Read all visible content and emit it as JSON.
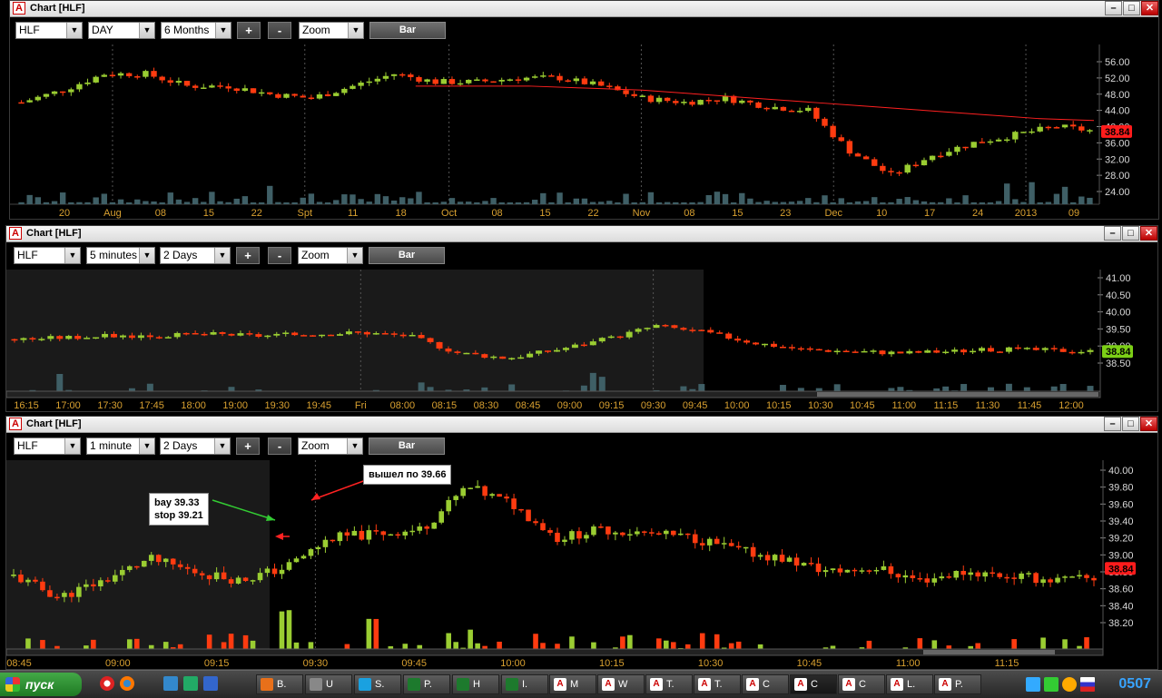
{
  "windows": [
    {
      "id": "w1",
      "title": "Chart [HLF]",
      "symbol": "HLF",
      "interval": "DAY",
      "range": "6 Months",
      "plus": "+",
      "minus": "-",
      "zoom": "Zoom",
      "bar": "Bar",
      "y_ticks": [
        "56.00",
        "52.00",
        "48.00",
        "44.00",
        "40.00",
        "36.00",
        "32.00",
        "28.00",
        "24.00"
      ],
      "last_price": "38.84",
      "x_ticks": [
        "20",
        "Aug",
        "08",
        "15",
        "22",
        "Spt",
        "11",
        "18",
        "Oct",
        "08",
        "15",
        "22",
        "Nov",
        "08",
        "15",
        "23",
        "Dec",
        "10",
        "17",
        "24",
        "2013",
        "09"
      ]
    },
    {
      "id": "w2",
      "title": "Chart [HLF]",
      "symbol": "HLF",
      "interval": "5 minutes",
      "range": "2 Days",
      "plus": "+",
      "minus": "-",
      "zoom": "Zoom",
      "bar": "Bar",
      "y_ticks": [
        "41.00",
        "40.50",
        "40.00",
        "39.50",
        "39.00",
        "38.50"
      ],
      "last_price": "38.84",
      "x_ticks": [
        "16:15",
        "17:00",
        "17:30",
        "17:45",
        "18:00",
        "19:00",
        "19:30",
        "19:45",
        "Fri",
        "08:00",
        "08:15",
        "08:30",
        "08:45",
        "09:00",
        "09:15",
        "09:30",
        "09:45",
        "10:00",
        "10:15",
        "10:30",
        "10:45",
        "11:00",
        "11:15",
        "11:30",
        "11:45",
        "12:00"
      ]
    },
    {
      "id": "w3",
      "title": "Chart [HLF]",
      "symbol": "HLF",
      "interval": "1 minute",
      "range": "2 Days",
      "plus": "+",
      "minus": "-",
      "zoom": "Zoom",
      "bar": "Bar",
      "y_ticks": [
        "40.00",
        "39.80",
        "39.60",
        "39.40",
        "39.20",
        "39.00",
        "38.80",
        "38.60",
        "38.40",
        "38.20"
      ],
      "last_price": "38.84",
      "x_ticks": [
        "08:45",
        "09:00",
        "09:15",
        "09:30",
        "09:45",
        "10:00",
        "10:15",
        "10:30",
        "10:45",
        "11:00",
        "11:15"
      ],
      "annotations": {
        "entry": "bay 39.33\nstop 39.21",
        "exit": "вышел по 39.66"
      }
    }
  ],
  "taskbar": {
    "start": "пуск",
    "tasks": [
      {
        "label": "B.",
        "icon": "firefox-icon",
        "color": "#e8701a"
      },
      {
        "label": "U",
        "icon": "app-icon",
        "color": "#888"
      },
      {
        "label": "S.",
        "icon": "skype-icon",
        "color": "#1aa1e0"
      },
      {
        "label": "P.",
        "icon": "excel-icon",
        "color": "#1d7a2d"
      },
      {
        "label": "H",
        "icon": "excel-icon",
        "color": "#1d7a2d"
      },
      {
        "label": "I.",
        "icon": "excel-icon",
        "color": "#1d7a2d"
      },
      {
        "label": "M",
        "icon": "chart-app-icon",
        "color": "#fff"
      },
      {
        "label": "W",
        "icon": "chart-app-icon",
        "color": "#fff"
      },
      {
        "label": "T.",
        "icon": "chart-app-icon",
        "color": "#fff"
      },
      {
        "label": "T.",
        "icon": "chart-app-icon",
        "color": "#fff"
      },
      {
        "label": "C",
        "icon": "chart-app-icon",
        "color": "#fff"
      },
      {
        "label": "C",
        "icon": "chart-app-icon",
        "color": "#fff",
        "active": true
      },
      {
        "label": "C",
        "icon": "chart-app-icon",
        "color": "#fff"
      },
      {
        "label": "L.",
        "icon": "chart-app-icon",
        "color": "#fff"
      },
      {
        "label": "P.",
        "icon": "chart-app-icon",
        "color": "#fff"
      }
    ],
    "clock": "0507"
  },
  "colors": {
    "up": "#9acd32",
    "down": "#ff3b10",
    "ma": "#ff2020",
    "volume": "#3f5f66",
    "price_tag": "#ff1c1c",
    "price_tag2": "#7ccf16"
  }
}
